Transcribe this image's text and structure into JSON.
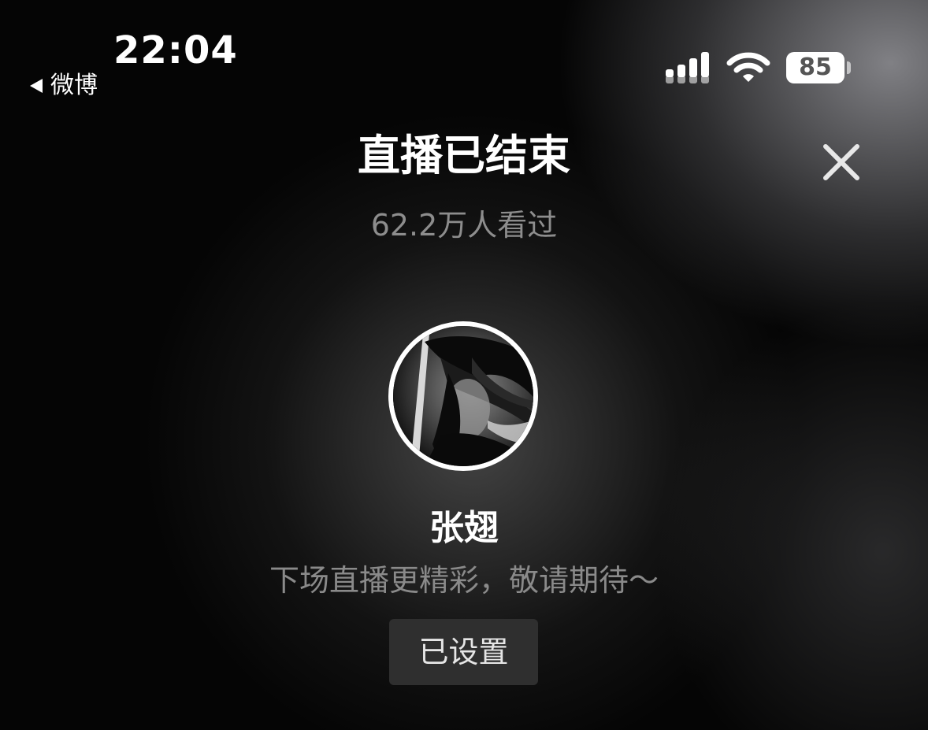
{
  "status_bar": {
    "time": "22:04",
    "back_app": "微博",
    "battery_level": "85",
    "signal_icon": "cellular-signal-icon",
    "wifi_icon": "wifi-icon"
  },
  "header": {
    "title": "直播已结束",
    "close_icon": "close-icon"
  },
  "stats": {
    "viewers": "62.2万人看过"
  },
  "streamer": {
    "name": "张翅",
    "message": "下场直播更精彩，敬请期待～"
  },
  "actions": {
    "reminder_label": "已设置"
  }
}
